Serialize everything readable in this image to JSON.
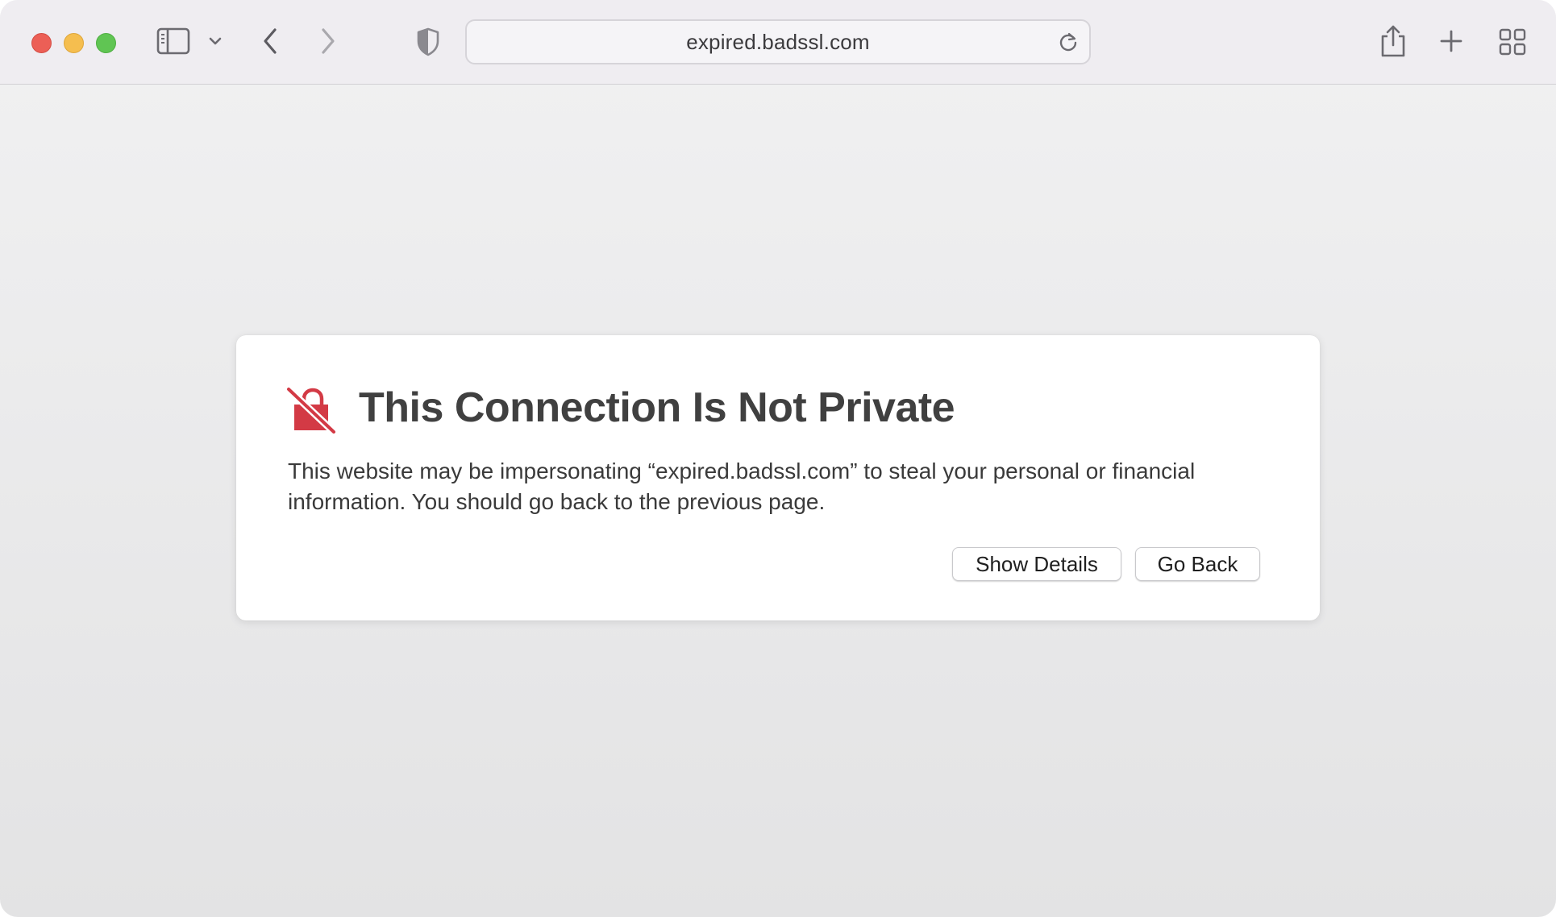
{
  "browser": {
    "address_bar": {
      "url": "expired.badssl.com"
    },
    "icons": {
      "close": "close-icon",
      "minimize": "minimize-icon",
      "maximize": "maximize-icon",
      "sidebar": "sidebar-icon",
      "sidebar_menu": "chevron-down-icon",
      "back": "chevron-left-icon",
      "forward": "chevron-right-icon",
      "privacy": "shield-icon",
      "reload": "reload-icon",
      "share": "share-icon",
      "new_tab": "plus-icon",
      "tab_overview": "grid-icon"
    }
  },
  "warning": {
    "icon": "broken-lock-icon",
    "title": "This Connection Is Not Private",
    "body": "This website may be impersonating “expired.badssl.com” to steal your personal or financial information. You should go back to the previous page.",
    "buttons": {
      "show_details": "Show Details",
      "go_back": "Go Back"
    }
  },
  "colors": {
    "warning_red": "#d33a45",
    "title_gray": "#404040",
    "toolbar": "#efedf1"
  }
}
